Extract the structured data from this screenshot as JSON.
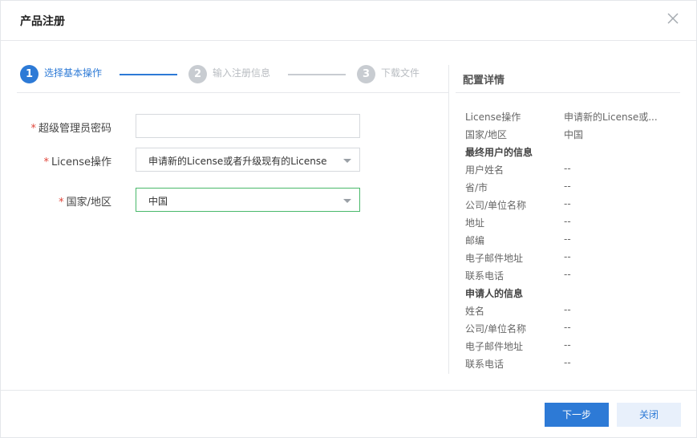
{
  "dialog": {
    "title": "产品注册",
    "close_icon": "close-icon"
  },
  "steps": [
    {
      "number": "1",
      "label": "选择基本操作",
      "state": "active"
    },
    {
      "number": "2",
      "label": "输入注册信息",
      "state": "inactive"
    },
    {
      "number": "3",
      "label": "下载文件",
      "state": "inactive"
    }
  ],
  "form": {
    "required_mark": "*",
    "password": {
      "label": "超级管理员密码",
      "value": ""
    },
    "license_op": {
      "label": "License操作",
      "value": "申请新的License或者升级现有的License"
    },
    "country": {
      "label": "国家/地区",
      "value": "中国"
    }
  },
  "details": {
    "title": "配置详情",
    "rows": [
      {
        "k": "License操作",
        "v": "申请新的License或...",
        "section": false
      },
      {
        "k": "国家/地区",
        "v": "中国",
        "section": false
      },
      {
        "k": "最终用户的信息",
        "v": "",
        "section": true
      },
      {
        "k": "用户姓名",
        "v": "--",
        "section": false
      },
      {
        "k": "省/市",
        "v": "--",
        "section": false
      },
      {
        "k": "公司/单位名称",
        "v": "--",
        "section": false
      },
      {
        "k": "地址",
        "v": "--",
        "section": false
      },
      {
        "k": "邮编",
        "v": "--",
        "section": false
      },
      {
        "k": "电子邮件地址",
        "v": "--",
        "section": false
      },
      {
        "k": "联系电话",
        "v": "--",
        "section": false
      },
      {
        "k": "申请人的信息",
        "v": "",
        "section": true
      },
      {
        "k": "姓名",
        "v": "--",
        "section": false
      },
      {
        "k": "公司/单位名称",
        "v": "--",
        "section": false
      },
      {
        "k": "电子邮件地址",
        "v": "--",
        "section": false
      },
      {
        "k": "联系电话",
        "v": "--",
        "section": false
      }
    ]
  },
  "footer": {
    "next_label": "下一步",
    "close_label": "关闭"
  },
  "colors": {
    "accent": "#2d7ad6",
    "inactive": "#c8ccd1",
    "required": "#e0453a",
    "focus_border": "#49b86a"
  }
}
